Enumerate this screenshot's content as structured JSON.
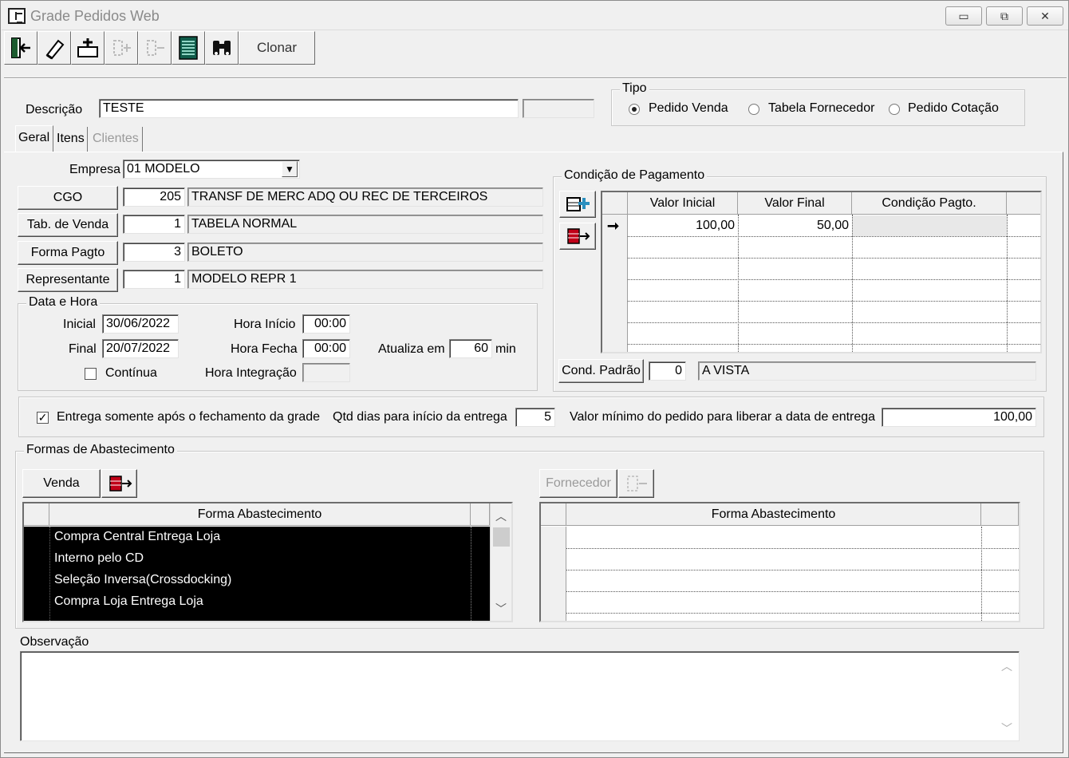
{
  "window": {
    "title": "Grade Pedidos Web",
    "controls": [
      "▭",
      "⧉",
      "✕"
    ]
  },
  "toolbar": {
    "clonar_label": "Clonar"
  },
  "header": {
    "descricao_label": "Descrição",
    "descricao_value": "TESTE",
    "tipo_label": "Tipo",
    "tipo_options": [
      "Pedido Venda",
      "Tabela Fornecedor",
      "Pedido Cotação"
    ],
    "tipo_selected": "Pedido Venda"
  },
  "tabs": [
    "Geral",
    "Itens",
    "Clientes"
  ],
  "geral": {
    "empresa_label": "Empresa",
    "empresa_value": "01 MODELO",
    "cgo": {
      "button": "CGO",
      "code": "205",
      "desc": "TRANSF DE MERC ADQ OU REC DE TERCEIROS"
    },
    "tab_venda": {
      "button": "Tab. de Venda",
      "code": "1",
      "desc": "TABELA NORMAL"
    },
    "forma_pagto": {
      "button": "Forma Pagto",
      "code": "3",
      "desc": "BOLETO"
    },
    "representante": {
      "button": "Representante",
      "code": "1",
      "desc": "MODELO REPR 1"
    }
  },
  "data_hora": {
    "group_label": "Data e Hora",
    "inicial_label": "Inicial",
    "inicial_value": "30/06/2022",
    "final_label": "Final",
    "final_value": "20/07/2022",
    "continua_label": "Contínua",
    "hora_inicio_label": "Hora Início",
    "hora_inicio_value": "00:00",
    "hora_fecha_label": "Hora Fecha",
    "hora_fecha_value": "00:00",
    "hora_integracao_label": "Hora Integração",
    "hora_integracao_value": "",
    "atualiza_label": "Atualiza em",
    "atualiza_value": "60",
    "atualiza_unit": "min"
  },
  "condicao": {
    "group_label": "Condição de Pagamento",
    "columns": [
      "Valor Inicial",
      "Valor Final",
      "Condição Pagto."
    ],
    "rows": [
      {
        "valor_inicial": "100,00",
        "valor_final": "50,00",
        "condicao": ""
      }
    ],
    "row_indicator": "➞",
    "cond_padrao_button": "Cond. Padrão",
    "cond_padrao_code": "0",
    "cond_padrao_desc": "A VISTA"
  },
  "entrega": {
    "checkbox_label": "Entrega somente após o fechamento da grade",
    "checked": true,
    "qtd_dias_label": "Qtd dias para início da entrega",
    "qtd_dias_value": "5",
    "valor_minimo_label": "Valor mínimo do pedido para liberar a data de entrega",
    "valor_minimo_value": "100,00"
  },
  "abastecimento": {
    "group_label": "Formas de Abastecimento",
    "venda_button": "Venda",
    "fornecedor_button": "Fornecedor",
    "left_column": "Forma Abastecimento",
    "right_column": "Forma Abastecimento",
    "left_rows": [
      "Compra Central Entrega Loja",
      "Interno pelo CD",
      "Seleção Inversa(Crossdocking)",
      "Compra Loja Entrega Loja"
    ]
  },
  "observacao": {
    "label": "Observação",
    "value": ""
  },
  "icons": [
    "exit-icon",
    "eraser-icon",
    "add-record-icon",
    "insert-disabled-icon",
    "delete-disabled-icon",
    "list-icon",
    "binoculars-icon"
  ]
}
